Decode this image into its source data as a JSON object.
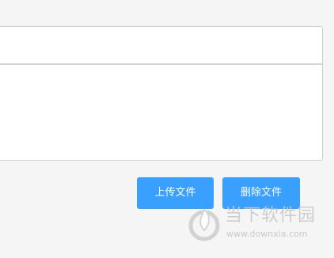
{
  "buttons": {
    "upload_label": "上传文件",
    "delete_label": "删除文件"
  },
  "watermark": {
    "title": "当下软件园",
    "url": "www.downxia.com"
  },
  "colors": {
    "button_bg": "#3aa0ff",
    "page_bg": "#f5f5f5",
    "panel_border": "#cfcfcf"
  }
}
